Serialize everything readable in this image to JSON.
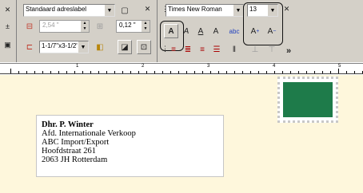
{
  "toolbar": {
    "label_type": "Standaard adreslabel",
    "font_name": "Times New Roman",
    "font_size": "13",
    "left_margin": "2,54 \"",
    "spacing": "0,12 \"",
    "label_size": "1-1/7\"x3-1/2\"",
    "button_bold_a": "A",
    "button_italic_a": "A",
    "button_underline_a": "A",
    "button_outline_a": "A",
    "button_grow_a": "A",
    "button_shrink_a": "A",
    "overflow": "»"
  },
  "ruler": {
    "numbers": [
      "1",
      "2",
      "3",
      "4",
      "5"
    ]
  },
  "address": {
    "lines": [
      "Dhr. P. Winter",
      "Afd. Internationale Verkoop",
      "ABC Import/Export",
      "Hoofdstraat 261",
      "2063 JH  Rotterdam"
    ]
  },
  "colors": {
    "stamp": "#1e7b4a",
    "envelope": "#fef7dc",
    "toolbar": "#d4d0c8"
  }
}
